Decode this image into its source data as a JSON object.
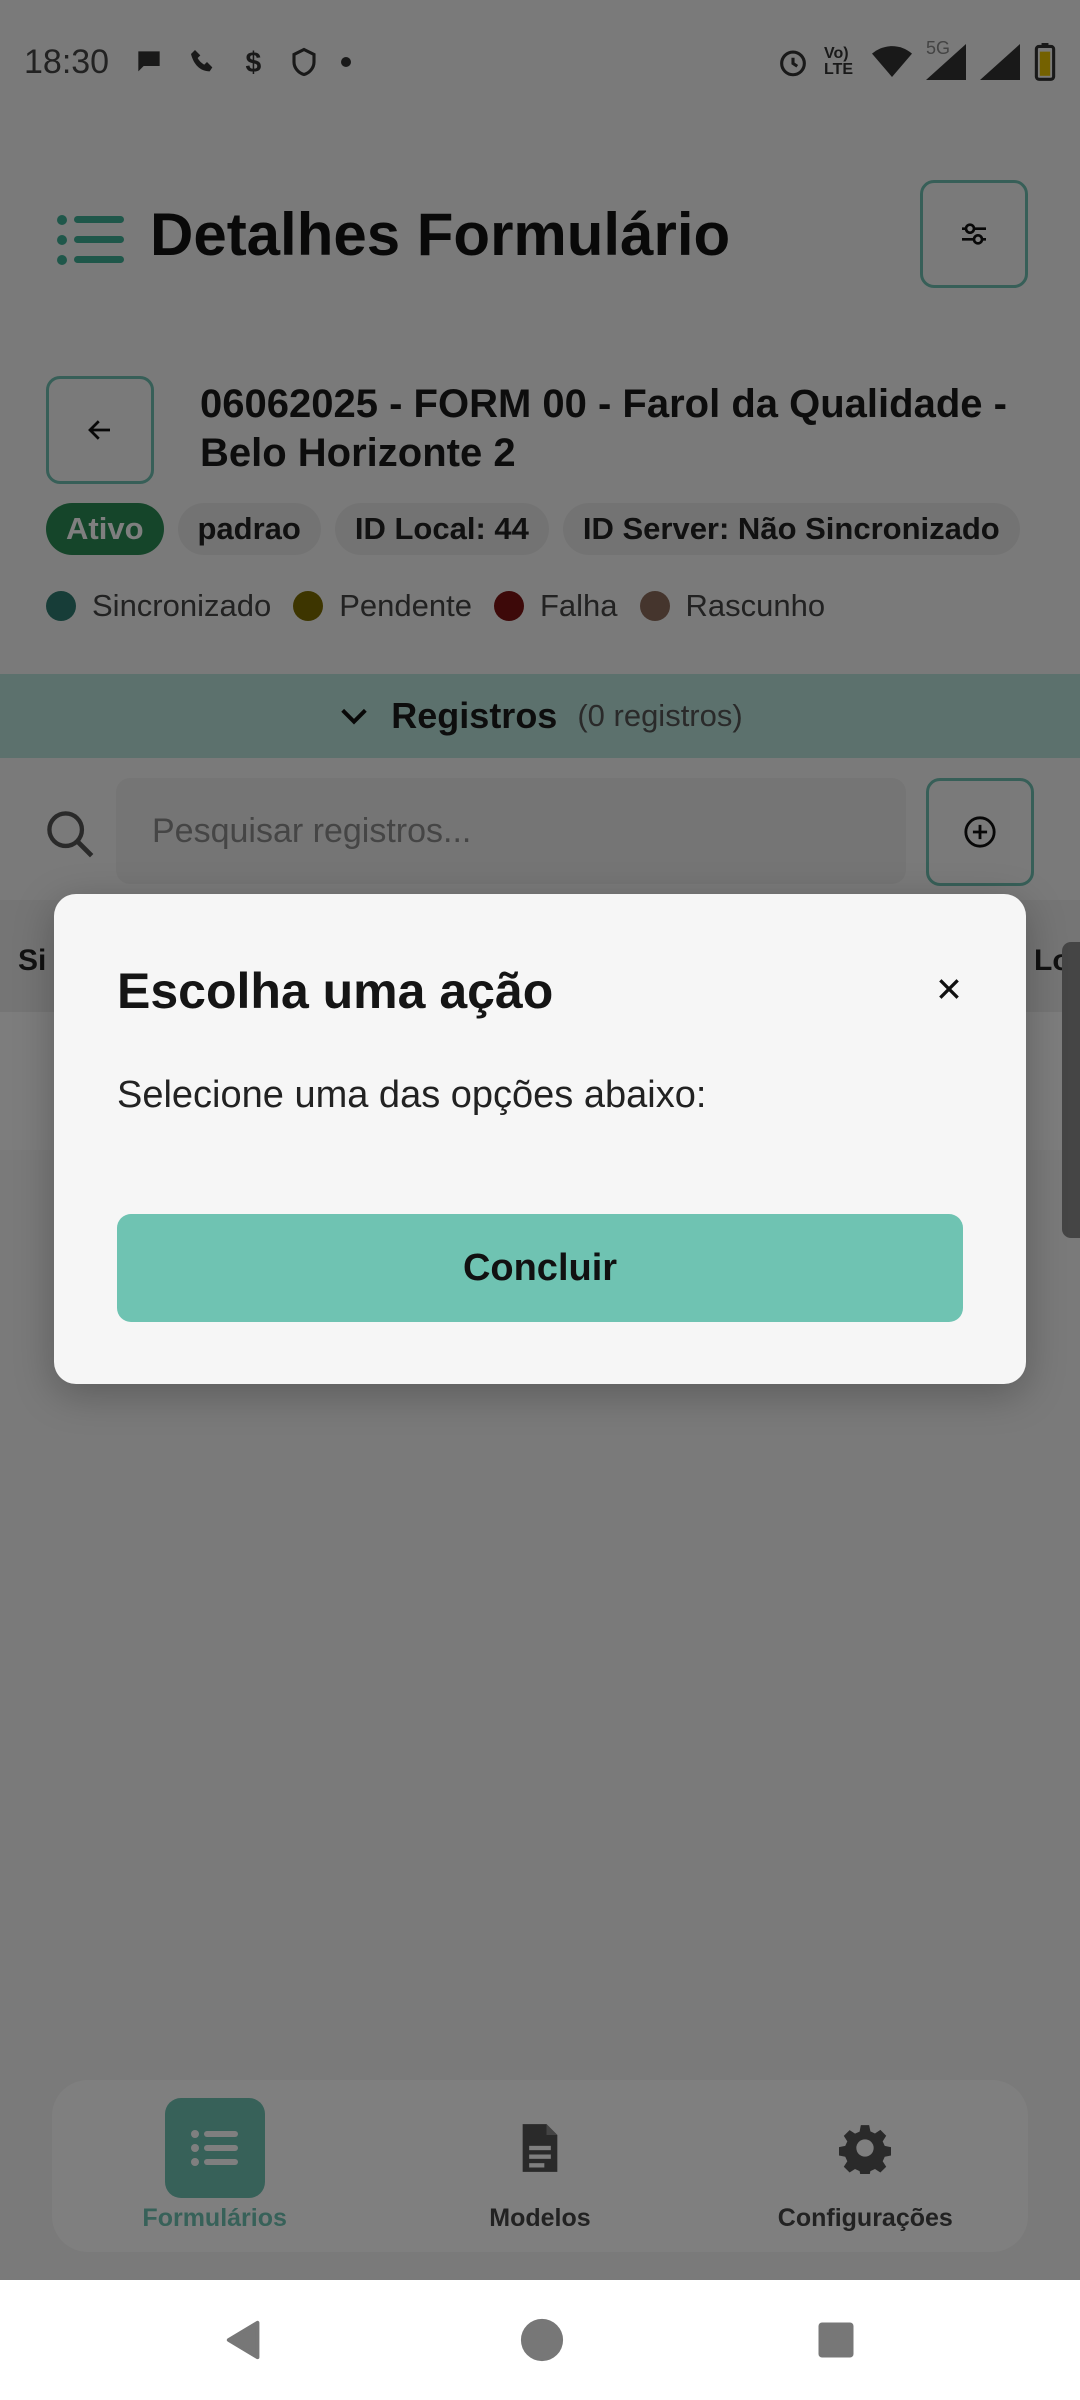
{
  "status_bar": {
    "time": "18:30",
    "left_icons": [
      "chat-icon",
      "phone-icon",
      "dollar-icon",
      "shield-icon",
      "dot-icon"
    ],
    "right_icons": [
      "alarm-icon",
      "volte-icon",
      "wifi-icon",
      "signal-5g-icon",
      "signal-icon",
      "battery-icon"
    ],
    "volte_label": "Vo) LTE",
    "network_label": "5G"
  },
  "header": {
    "title": "Detalhes Formulário"
  },
  "form": {
    "title": "06062025 - FORM 00 - Farol da Qualidade - Belo Horizonte 2",
    "chips": [
      {
        "label": "Ativo",
        "active": true
      },
      {
        "label": "padrao",
        "active": false
      },
      {
        "label": "ID Local: 44",
        "active": false
      },
      {
        "label": "ID Server: Não Sincronizado",
        "active": false
      }
    ],
    "legend": [
      {
        "label": "Sincronizado",
        "color": "#2f7a70"
      },
      {
        "label": "Pendente",
        "color": "#7a6a00"
      },
      {
        "label": "Falha",
        "color": "#7a1212"
      },
      {
        "label": "Rascunho",
        "color": "#8a6a5a"
      }
    ]
  },
  "registros": {
    "title": "Registros",
    "count": "(0 registros)"
  },
  "search": {
    "placeholder": "Pesquisar registros..."
  },
  "table": {
    "left_header_partial": "Si",
    "right_header_partial": "Lo"
  },
  "dialog": {
    "title": "Escolha uma ação",
    "message": "Selecione uma das opções abaixo:",
    "primary_button": "Concluir"
  },
  "bottom_nav": {
    "items": [
      {
        "label": "Formulários",
        "icon": "list-icon",
        "active": true
      },
      {
        "label": "Modelos",
        "icon": "document-icon",
        "active": false
      },
      {
        "label": "Configurações",
        "icon": "gear-icon",
        "active": false
      }
    ]
  },
  "colors": {
    "accent": "#6fc3b2",
    "active_chip": "#2a8a55",
    "registros_bar": "#b9e3da"
  }
}
